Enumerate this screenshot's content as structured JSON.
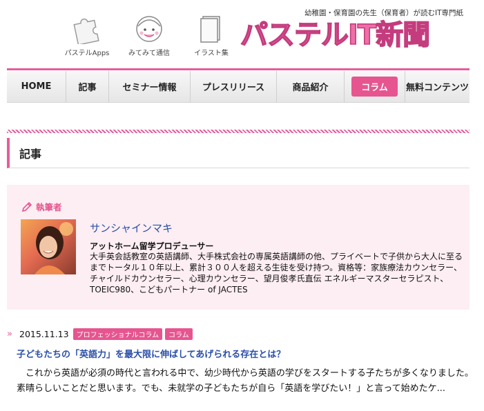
{
  "header": {
    "tagline": "幼稚園・保育園の先生（保育者）が読むIT専門紙",
    "logo": "パステルIT新聞",
    "icons": [
      {
        "label": "パステルApps",
        "icon": "puzzle-icon"
      },
      {
        "label": "みてみて通信",
        "icon": "smiley-icon"
      },
      {
        "label": "イラスト集",
        "icon": "book-icon"
      }
    ]
  },
  "nav": {
    "items": [
      {
        "label": "HOME",
        "width": 86
      },
      {
        "label": "記事",
        "width": 62
      },
      {
        "label": "セミナー情報",
        "width": 118
      },
      {
        "label": "プレスリリース",
        "width": 125
      },
      {
        "label": "商品紹介",
        "width": 98
      },
      {
        "label": "コラム",
        "width": 88
      },
      {
        "label": "無料コンテンツ",
        "width": 93
      }
    ],
    "active": "コラム"
  },
  "section": {
    "title": "記事"
  },
  "author": {
    "label": "執筆者",
    "name": "サンシャインマキ",
    "role": "アットホーム留学プロデューサー",
    "bio": "大手英会話教室の英語講師、大手株式会社の専属英語講師の他、プライベートで子供から大人に至るまでトータル１０年以上、累計３００人を超える生徒を受け持つ。資格等：家族療法カウンセラー、チャイルドカウンセラー、心理カウンセラー、望月俊孝氏直伝 エネルギーマスターセラピスト、TOEIC980、こどもパートナー of JACTES"
  },
  "article": {
    "date": "2015.11.13",
    "tags": [
      "プロフェッショナルコラム",
      "コラム"
    ],
    "title": "子どもたちの「英語力」を最大限に伸ばしてあげられる存在とは？",
    "excerpt": "これから英語が必須の時代と言われる中で、幼少時代から英語の学びをスタートする子たちが多くなりました。素晴らしいことだと思います。でも、未就学の子どもたちが自ら「英語を学びたい！」と言って始めたケ..."
  },
  "colors": {
    "accent": "#e6558f",
    "link": "#2b4fa8",
    "author_bg": "#fdeef3"
  }
}
